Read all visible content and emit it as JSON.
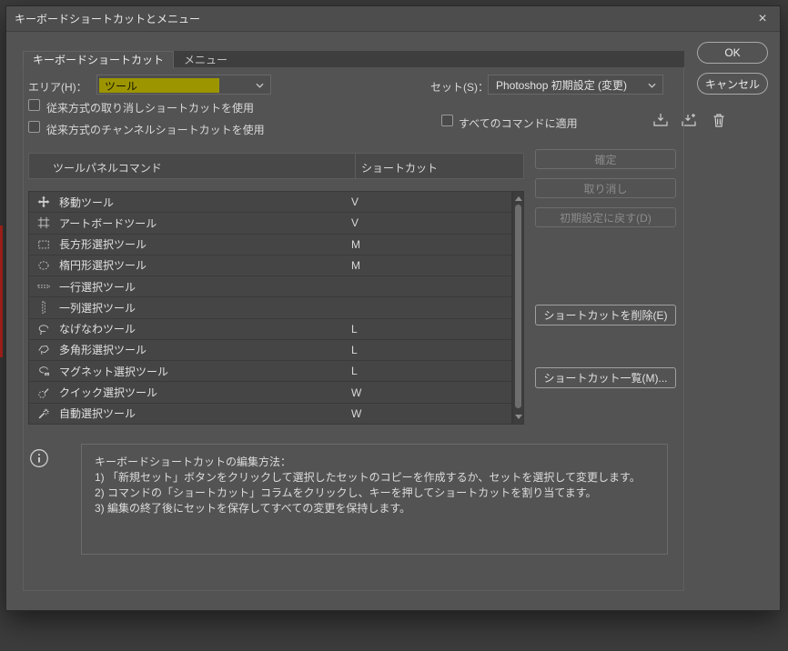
{
  "window": {
    "title": "キーボードショートカットとメニュー",
    "close_glyph": "×"
  },
  "tabs": [
    {
      "label": "キーボードショートカット",
      "active": true
    },
    {
      "label": "メニュー",
      "active": false
    }
  ],
  "actions": {
    "ok": "OK",
    "cancel": "キャンセル"
  },
  "filters": {
    "area_label": "エリア(H)：",
    "area_value": "ツール",
    "set_label": "セット(S)：",
    "set_value": "Photoshop 初期設定 (変更)"
  },
  "options": {
    "legacy_undo": "従来方式の取り消しショートカットを使用",
    "legacy_channel": "従来方式のチャンネルショートカットを使用",
    "apply_all": "すべてのコマンドに適用"
  },
  "table": {
    "headers": {
      "command": "ツールパネルコマンド",
      "shortcut": "ショートカット"
    },
    "rows": [
      {
        "tool": "移動ツール",
        "shortcut": "V",
        "icon": "move-tool"
      },
      {
        "tool": "アートボードツール",
        "shortcut": "V",
        "icon": "artboard-tool"
      },
      {
        "tool": "長方形選択ツール",
        "shortcut": "M",
        "icon": "rect-marquee"
      },
      {
        "tool": "楕円形選択ツール",
        "shortcut": "M",
        "icon": "ellipse-marquee"
      },
      {
        "tool": "一行選択ツール",
        "shortcut": "",
        "icon": "single-row-marquee"
      },
      {
        "tool": "一列選択ツール",
        "shortcut": "",
        "icon": "single-column-marquee"
      },
      {
        "tool": "なげなわツール",
        "shortcut": "L",
        "icon": "lasso"
      },
      {
        "tool": "多角形選択ツール",
        "shortcut": "L",
        "icon": "polygonal-lasso"
      },
      {
        "tool": "マグネット選択ツール",
        "shortcut": "L",
        "icon": "magnetic-lasso"
      },
      {
        "tool": "クイック選択ツール",
        "shortcut": "W",
        "icon": "quick-selection"
      },
      {
        "tool": "自動選択ツール",
        "shortcut": "W",
        "icon": "magic-wand"
      }
    ]
  },
  "side_buttons": {
    "accept": "確定",
    "undo": "取り消し",
    "use_default": "初期設定に戻す(D)",
    "delete_shortcut": "ショートカットを削除(E)",
    "summary": "ショートカット一覧(M)..."
  },
  "help": {
    "lines": [
      "キーボードショートカットの編集方法：",
      "1) 「新規セット」ボタンをクリックして選択したセットのコピーを作成するか、セットを選択して変更します。",
      "2) コマンドの「ショートカット」コラムをクリックし、キーを押してショートカットを割り当てます。",
      "3) 編集の終了後にセットを保存してすべての変更を保持します。"
    ]
  },
  "colors": {
    "selection_highlight": "#9c9500",
    "accent_red": "#c1271f"
  }
}
